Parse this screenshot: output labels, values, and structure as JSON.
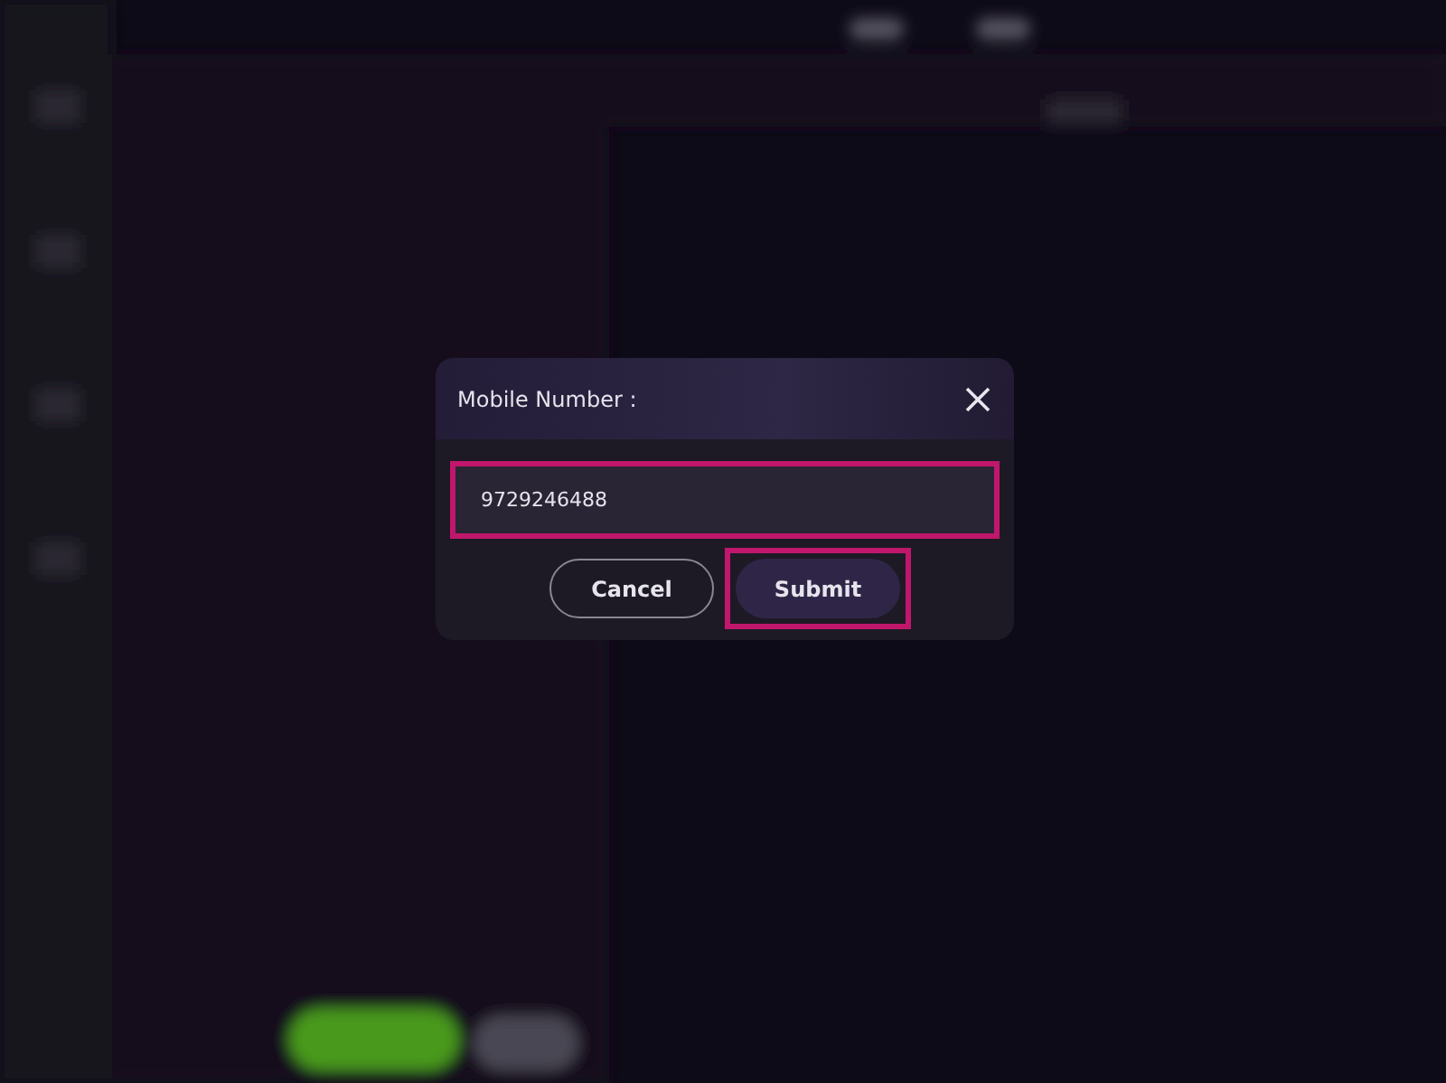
{
  "dialog": {
    "title": "Mobile Number :",
    "field": {
      "value": "9729246488",
      "highlighted": true
    },
    "buttons": [
      {
        "label": "Cancel",
        "kind": "outline",
        "highlighted": false
      },
      {
        "label": "Submit",
        "kind": "primary",
        "highlighted": true
      }
    ]
  }
}
